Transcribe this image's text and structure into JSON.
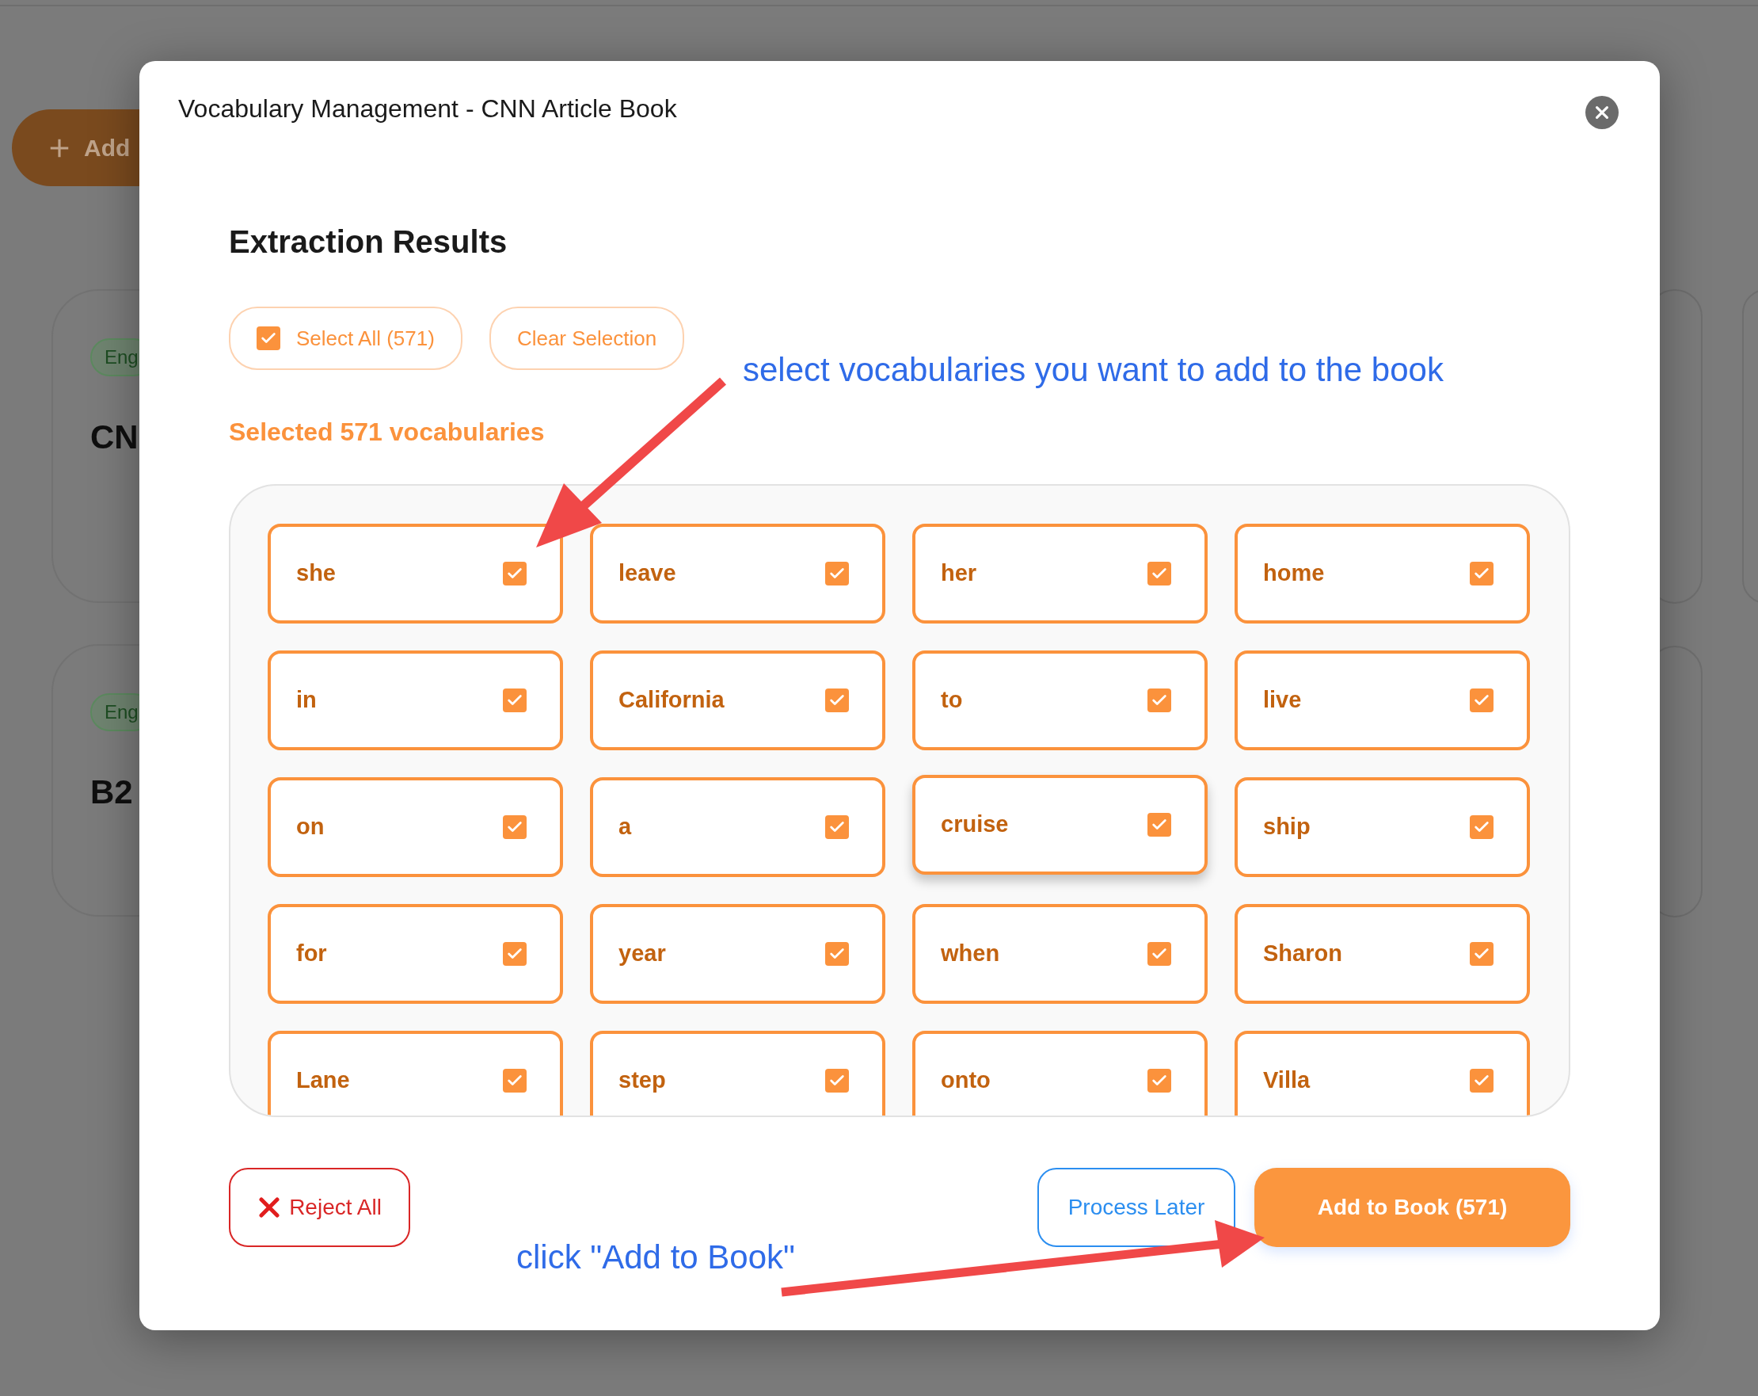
{
  "background": {
    "add_button": "Add",
    "cards": [
      {
        "tag": "Eng",
        "title": "CN"
      },
      {
        "tag": "Eng",
        "title": "B2"
      }
    ]
  },
  "dialog": {
    "title": "Vocabulary Management - CNN Article Book",
    "heading": "Extraction Results",
    "select_all": {
      "label": "Select All (571)",
      "checked": true
    },
    "clear_button": "Clear Selection",
    "selected_summary": "Selected 571 vocabularies",
    "words": [
      {
        "word": "she",
        "checked": true,
        "hovered": false
      },
      {
        "word": "leave",
        "checked": true,
        "hovered": false
      },
      {
        "word": "her",
        "checked": true,
        "hovered": false
      },
      {
        "word": "home",
        "checked": true,
        "hovered": false
      },
      {
        "word": "in",
        "checked": true,
        "hovered": false
      },
      {
        "word": "California",
        "checked": true,
        "hovered": false
      },
      {
        "word": "to",
        "checked": true,
        "hovered": false
      },
      {
        "word": "live",
        "checked": true,
        "hovered": false
      },
      {
        "word": "on",
        "checked": true,
        "hovered": false
      },
      {
        "word": "a",
        "checked": true,
        "hovered": false
      },
      {
        "word": "cruise",
        "checked": true,
        "hovered": true
      },
      {
        "word": "ship",
        "checked": true,
        "hovered": false
      },
      {
        "word": "for",
        "checked": true,
        "hovered": false
      },
      {
        "word": "year",
        "checked": true,
        "hovered": false
      },
      {
        "word": "when",
        "checked": true,
        "hovered": false
      },
      {
        "word": "Sharon",
        "checked": true,
        "hovered": false
      },
      {
        "word": "Lane",
        "checked": true,
        "hovered": false
      },
      {
        "word": "step",
        "checked": true,
        "hovered": false
      },
      {
        "word": "onto",
        "checked": true,
        "hovered": false
      },
      {
        "word": "Villa",
        "checked": true,
        "hovered": false
      }
    ],
    "reject_button": "Reject All",
    "later_button": "Process Later",
    "add_button": "Add to Book (571)"
  },
  "annotations": [
    {
      "text": "select vocabularies you want to add to the book"
    },
    {
      "text": "click \"Add to Book\""
    }
  ]
}
